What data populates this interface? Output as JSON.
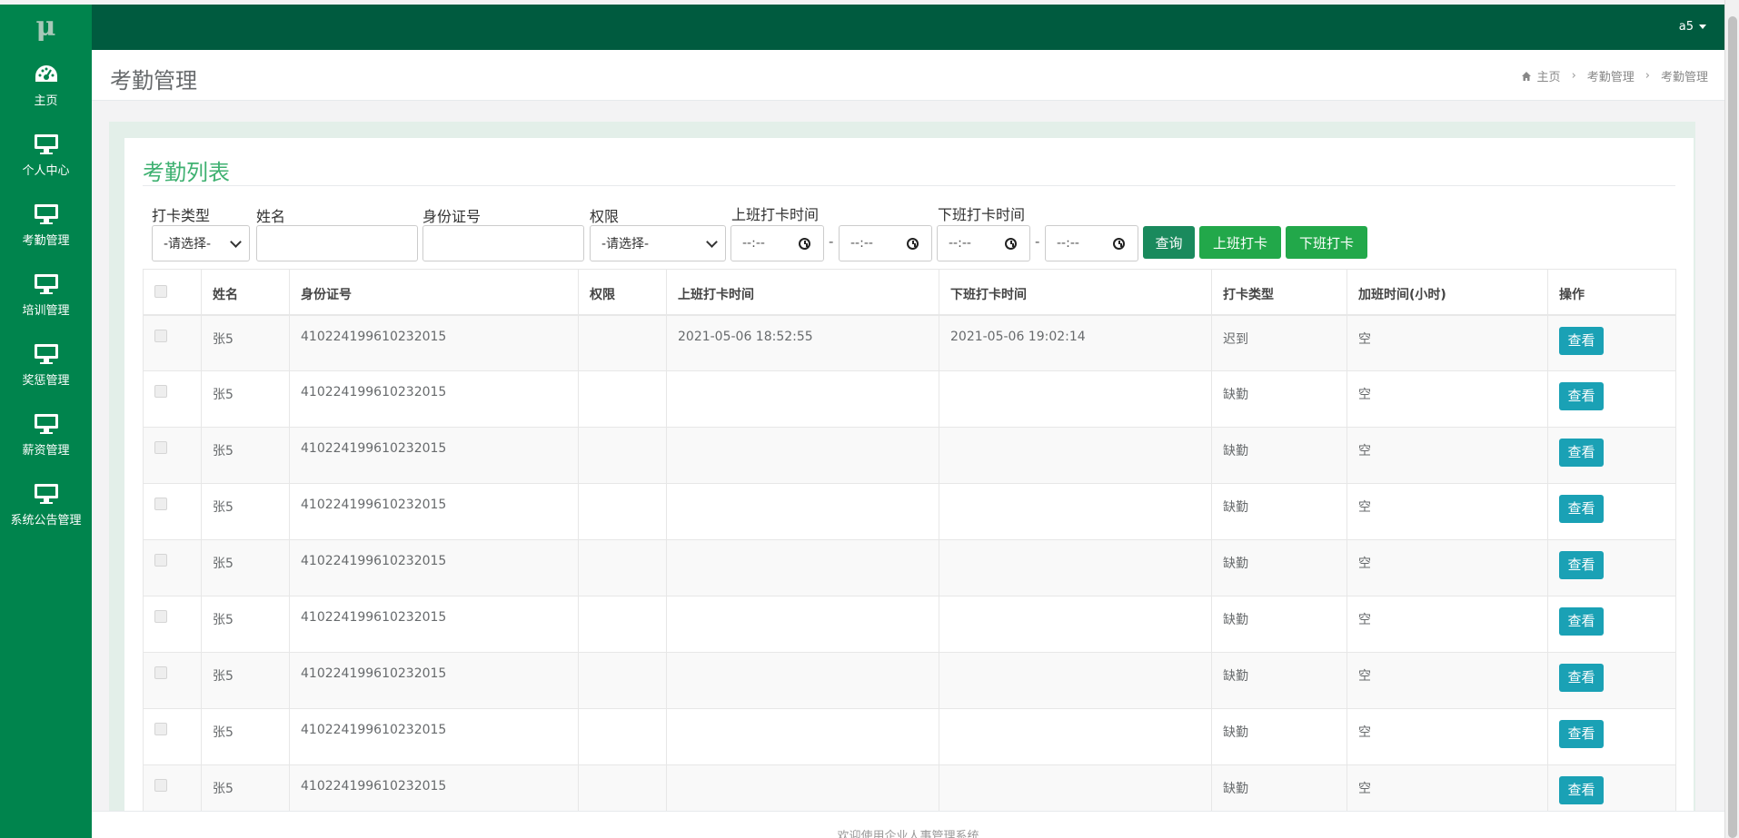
{
  "app": {
    "logo": "μ",
    "user": "a5"
  },
  "sidebar": {
    "items": [
      {
        "label": "主页",
        "icon": "dashboard-icon"
      },
      {
        "label": "个人中心",
        "icon": "monitor-icon"
      },
      {
        "label": "考勤管理",
        "icon": "monitor-icon"
      },
      {
        "label": "培训管理",
        "icon": "monitor-icon"
      },
      {
        "label": "奖惩管理",
        "icon": "monitor-icon"
      },
      {
        "label": "薪资管理",
        "icon": "monitor-icon"
      },
      {
        "label": "系统公告管理",
        "icon": "monitor-icon"
      }
    ]
  },
  "header": {
    "title": "考勤管理",
    "breadcrumb": [
      "主页",
      "考勤管理",
      "考勤管理"
    ]
  },
  "panel": {
    "title": "考勤列表"
  },
  "filters": {
    "type_label": "打卡类型",
    "type_value": "-请选择-",
    "name_label": "姓名",
    "name_value": "",
    "id_label": "身份证号",
    "id_value": "",
    "perm_label": "权限",
    "perm_value": "-请选择-",
    "in_label": "上班打卡时间",
    "out_label": "下班打卡时间",
    "time_placeholder": "--:--",
    "range_sep": "-",
    "query_btn": "查询",
    "clock_in_btn": "上班打卡",
    "clock_out_btn": "下班打卡"
  },
  "table": {
    "columns": [
      "姓名",
      "身份证号",
      "权限",
      "上班打卡时间",
      "下班打卡时间",
      "打卡类型",
      "加班时间(小时)",
      "操作"
    ],
    "view_label": "查看",
    "rows": [
      {
        "name": "张5",
        "id_no": "410224199610232015",
        "perm": "",
        "in_time": "2021-05-06 18:52:55",
        "out_time": "2021-05-06 19:02:14",
        "type": "迟到",
        "overtime": "空"
      },
      {
        "name": "张5",
        "id_no": "410224199610232015",
        "perm": "",
        "in_time": "",
        "out_time": "",
        "type": "缺勤",
        "overtime": "空"
      },
      {
        "name": "张5",
        "id_no": "410224199610232015",
        "perm": "",
        "in_time": "",
        "out_time": "",
        "type": "缺勤",
        "overtime": "空"
      },
      {
        "name": "张5",
        "id_no": "410224199610232015",
        "perm": "",
        "in_time": "",
        "out_time": "",
        "type": "缺勤",
        "overtime": "空"
      },
      {
        "name": "张5",
        "id_no": "410224199610232015",
        "perm": "",
        "in_time": "",
        "out_time": "",
        "type": "缺勤",
        "overtime": "空"
      },
      {
        "name": "张5",
        "id_no": "410224199610232015",
        "perm": "",
        "in_time": "",
        "out_time": "",
        "type": "缺勤",
        "overtime": "空"
      },
      {
        "name": "张5",
        "id_no": "410224199610232015",
        "perm": "",
        "in_time": "",
        "out_time": "",
        "type": "缺勤",
        "overtime": "空"
      },
      {
        "name": "张5",
        "id_no": "410224199610232015",
        "perm": "",
        "in_time": "",
        "out_time": "",
        "type": "缺勤",
        "overtime": "空"
      },
      {
        "name": "张5",
        "id_no": "410224199610232015",
        "perm": "",
        "in_time": "",
        "out_time": "",
        "type": "缺勤",
        "overtime": "空"
      }
    ]
  },
  "footer": {
    "text": "欢迎使用企业人事管理系统"
  },
  "colors": {
    "topbar": "#005b3f",
    "sidebar": "#00844d",
    "accent": "#3fb171",
    "view_button": "#1aa1b5"
  }
}
